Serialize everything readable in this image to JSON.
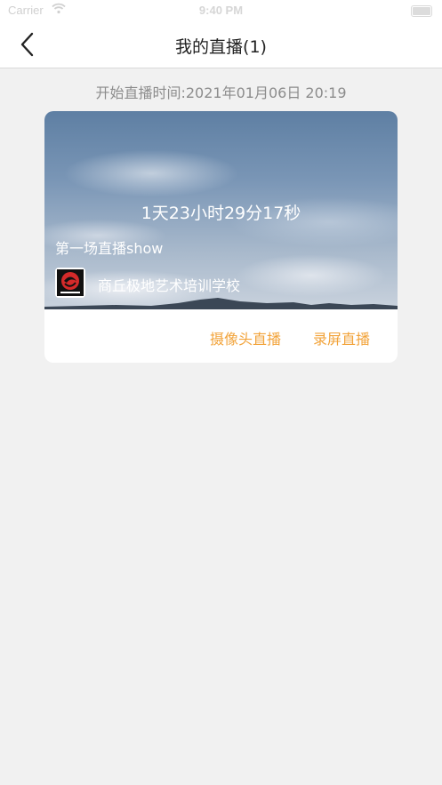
{
  "status_bar": {
    "carrier": "Carrier",
    "time": "9:40 PM"
  },
  "nav": {
    "title": "我的直播(1)",
    "back_icon": "chevron-left-icon"
  },
  "live": {
    "start_time": "开始直播时间:2021年01月06日 20:19",
    "countdown": "1天23小时29分17秒",
    "title": "第一场直播show",
    "school_name": "商丘极地艺术培训学校",
    "buttons": {
      "camera": "摄像头直播",
      "screen": "录屏直播"
    }
  },
  "colors": {
    "accent": "#f2a33a",
    "background": "#f1f1f1"
  }
}
